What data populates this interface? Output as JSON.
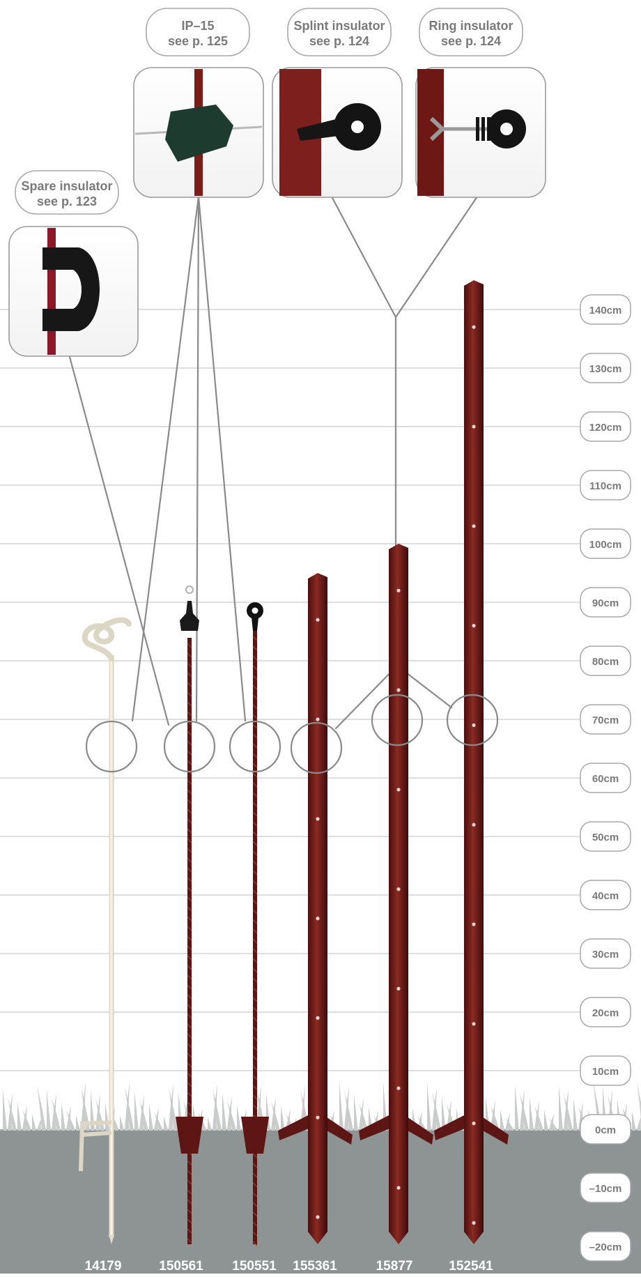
{
  "callouts": [
    {
      "id": "spare",
      "line1": "Spare insulator",
      "line2": "see p. 123",
      "icon": "spare-insulator-icon"
    },
    {
      "id": "ip15",
      "line1": "IP–15",
      "line2": "see p. 125",
      "icon": "ip15-insulator-icon"
    },
    {
      "id": "splint",
      "line1": "Splint insulator",
      "line2": "see p. 124",
      "icon": "splint-insulator-icon"
    },
    {
      "id": "ring",
      "line1": "Ring insulator",
      "line2": "see p. 124",
      "icon": "ring-insulator-icon"
    }
  ],
  "height_scale": {
    "unit": "cm",
    "labels": [
      "140cm",
      "130cm",
      "120cm",
      "110cm",
      "100cm",
      "90cm",
      "80cm",
      "70cm",
      "60cm",
      "50cm",
      "40cm",
      "30cm",
      "20cm",
      "10cm",
      "0cm",
      "–10cm",
      "–20cm"
    ],
    "values": [
      140,
      130,
      120,
      110,
      100,
      90,
      80,
      70,
      60,
      50,
      40,
      30,
      20,
      10,
      0,
      -10,
      -20
    ]
  },
  "posts": [
    {
      "code": "14179",
      "type": "pigtail post",
      "color": "#ece8d8",
      "top_cm": 90
    },
    {
      "code": "150561",
      "type": "rod post",
      "color": "#5a1612",
      "top_cm": 95
    },
    {
      "code": "150551",
      "type": "rod post",
      "color": "#5a1612",
      "top_cm": 91
    },
    {
      "code": "155361",
      "type": "angle post",
      "color": "#6a1a18",
      "top_cm": 95
    },
    {
      "code": "15877",
      "type": "angle post",
      "color": "#6a1a18",
      "top_cm": 100
    },
    {
      "code": "152541",
      "type": "angle post",
      "color": "#6a1a18",
      "top_cm": 145
    }
  ],
  "colors": {
    "grid": "#d4d4d4",
    "leader": "#8a8a8a",
    "ground": "#8e9493",
    "label": "#ffffff"
  }
}
